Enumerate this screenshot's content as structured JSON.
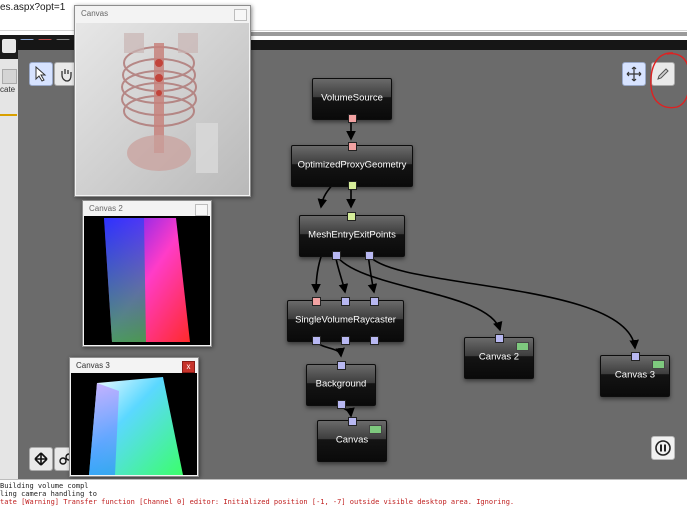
{
  "browser": {
    "url": "es.aspx?opt=1"
  },
  "left_panel": {
    "label": "cate"
  },
  "editor": {
    "tools": [
      {
        "name": "select-tool",
        "icon": "arrow-cursor-icon"
      },
      {
        "name": "pan-tool",
        "icon": "hand-icon"
      }
    ],
    "processors": [
      {
        "id": "VolumeSource",
        "label": "VolumeSource"
      },
      {
        "id": "OptimizedProxyGeometry",
        "label": "OptimizedProxyGeometry"
      },
      {
        "id": "MeshEntryExitPoints",
        "label": "MeshEntryExitPoints"
      },
      {
        "id": "SingleVolumeRaycaster",
        "label": "SingleVolumeRaycaster"
      },
      {
        "id": "Background",
        "label": "Background"
      },
      {
        "id": "Canvas",
        "label": "Canvas"
      },
      {
        "id": "Canvas2",
        "label": "Canvas 2"
      },
      {
        "id": "Canvas3",
        "label": "Canvas 3"
      }
    ]
  },
  "windows": {
    "canvas1": {
      "title": "Canvas"
    },
    "canvas2": {
      "title": "Canvas 2"
    },
    "canvas3": {
      "title": "Canvas 3"
    }
  },
  "log": {
    "line1": "Building volume compl",
    "line2": "ling camera handling to",
    "line3": "tate [Warning]  Transfer function [Channel 0] editor: Initialized position [-1, -7] outside visible desktop area. Ignoring."
  },
  "colors": {
    "editor_bg": "#6b6b6b",
    "port_image": "#f2a2a2",
    "port_geometry": "#d6ee9a",
    "port_render": "#b8b8f2",
    "annotation_red": "#e02020",
    "log_warning": "#c02020"
  }
}
